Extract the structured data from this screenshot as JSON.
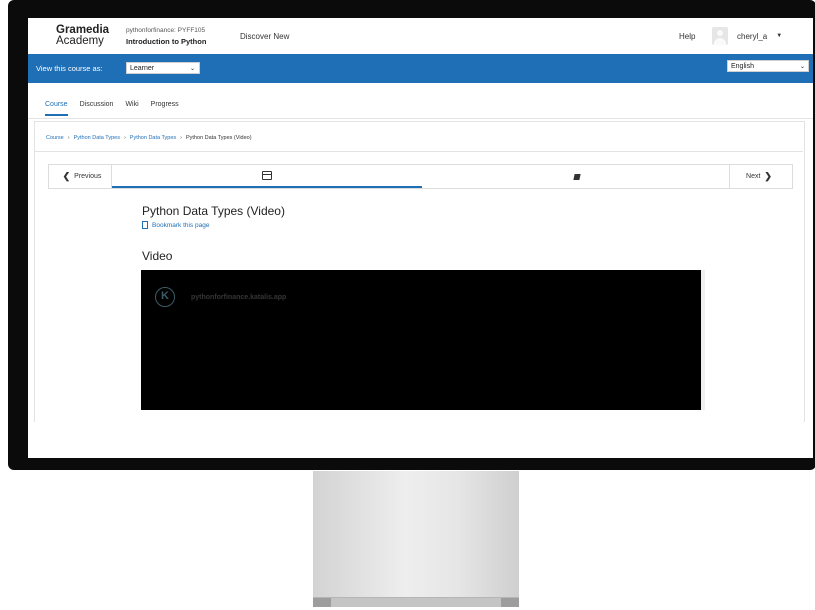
{
  "header": {
    "logo_line1": "Gramedia",
    "logo_line2": "Academy",
    "course_org": "pythonforfinance: PYFF105",
    "course_name": "Introduction to Python",
    "discover": "Discover New",
    "help": "Help",
    "username": "cheryl_a"
  },
  "course_bar": {
    "view_as_label": "View this course as:",
    "role_value": "Learner",
    "language_value": "English",
    "bar_color": "#1f6fb7"
  },
  "tabs": [
    "Course",
    "Discussion",
    "Wiki",
    "Progress"
  ],
  "breadcrumb": {
    "items": [
      "Course",
      "Python Data Types",
      "Python Data Types"
    ],
    "current": "Python Data Types (Video)"
  },
  "sequence_nav": {
    "previous": "Previous",
    "next": "Next",
    "units": [
      "video-icon",
      "book-icon"
    ]
  },
  "unit": {
    "title": "Python Data Types (Video)",
    "bookmark": "Bookmark this page",
    "section_heading": "Video"
  },
  "video": {
    "logo_letter": "K",
    "watermark": "pythonforfinance.katalis.app"
  }
}
